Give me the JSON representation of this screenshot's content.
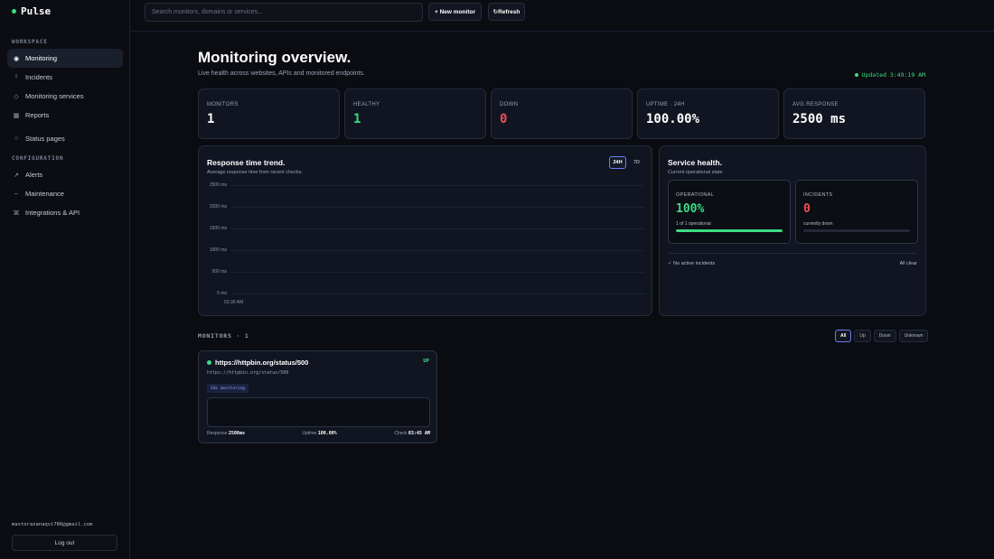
{
  "brand": {
    "name": "Pulse",
    "accent": "#3ddc84"
  },
  "sidebar": {
    "workspace_label": "WORKSPACE",
    "configuration_label": "CONFIGURATION",
    "items": [
      {
        "label": "Monitoring",
        "icon": "circle-icon",
        "glyph": "◉",
        "active": true
      },
      {
        "label": "Incidents",
        "icon": "exclamation-icon",
        "glyph": "!",
        "active": false
      },
      {
        "label": "Monitoring services",
        "icon": "diamond-icon",
        "glyph": "◇",
        "active": false
      },
      {
        "label": "Reports",
        "icon": "grid-icon",
        "glyph": "▦",
        "active": false
      },
      {
        "label": "Status pages",
        "icon": "dot-icon",
        "glyph": "○",
        "active": false
      }
    ],
    "config_items": [
      {
        "label": "Alerts",
        "icon": "arrow-icon",
        "glyph": "↗"
      },
      {
        "label": "Maintenance",
        "icon": "dash-icon",
        "glyph": "–"
      },
      {
        "label": "Integrations & API",
        "icon": "puzzle-icon",
        "glyph": "⌘"
      }
    ],
    "user_email": "mastorazanaqvi786@gmail.com",
    "logout_label": "Log out"
  },
  "topbar": {
    "search_placeholder": "Search monitors, domains or services...",
    "new_monitor_label": "+ New monitor",
    "refresh_label": "↻Refresh"
  },
  "header": {
    "title": "Monitoring overview.",
    "subtitle": "Live health across websites, APIs and monitored endpoints.",
    "updated": "Updated 3:49:19 AM"
  },
  "stats": [
    {
      "label": "MONITORS",
      "value": "1",
      "tone": ""
    },
    {
      "label": "HEALTHY",
      "value": "1",
      "tone": "green"
    },
    {
      "label": "DOWN",
      "value": "0",
      "tone": "red"
    },
    {
      "label": "UPTIME · 24H",
      "value": "100.00%",
      "tone": ""
    },
    {
      "label": "AVG RESPONSE",
      "value": "2500 ms",
      "tone": ""
    }
  ],
  "trend": {
    "title": "Response time trend.",
    "subtitle": "Average response time from recent checks.",
    "range_options": [
      "24H",
      "7D"
    ],
    "range_selected": "24H"
  },
  "chart_data": {
    "type": "line",
    "title": "Response time trend.",
    "y_ticks": [
      "2500 ms",
      "2000 ms",
      "1500 ms",
      "1000 ms",
      "500 ms",
      "0 ms"
    ],
    "ylim": [
      0,
      2500
    ],
    "x_ticks": [
      "03:30 AM"
    ],
    "series": [],
    "grid": true
  },
  "health": {
    "title": "Service health.",
    "subtitle": "Current operational state.",
    "operational_label": "OPERATIONAL",
    "operational_value": "100%",
    "operational_note": "1 of 1 operational",
    "operational_fraction": 1.0,
    "incidents_label": "INCIDENTS",
    "incidents_value": "0",
    "incidents_note": "currently down",
    "incidents_fraction": 0.0,
    "footer_left": "✓ No active incidents",
    "footer_right": "All clear"
  },
  "monitors_section": {
    "label": "MONITORS · 1",
    "filters": [
      "All",
      "Up",
      "Down",
      "Unknown"
    ],
    "filter_selected": "All",
    "items": [
      {
        "name": "https://httpbin.org/status/500",
        "url": "https://httpbin.org/status/500",
        "status": "UP",
        "tag": "SSL monitoring",
        "response_label": "Response",
        "response": "2500ms",
        "uptime_label": "Uptime",
        "uptime": "100.00%",
        "check_label": "Check",
        "check": "03:45 AM"
      }
    ]
  }
}
